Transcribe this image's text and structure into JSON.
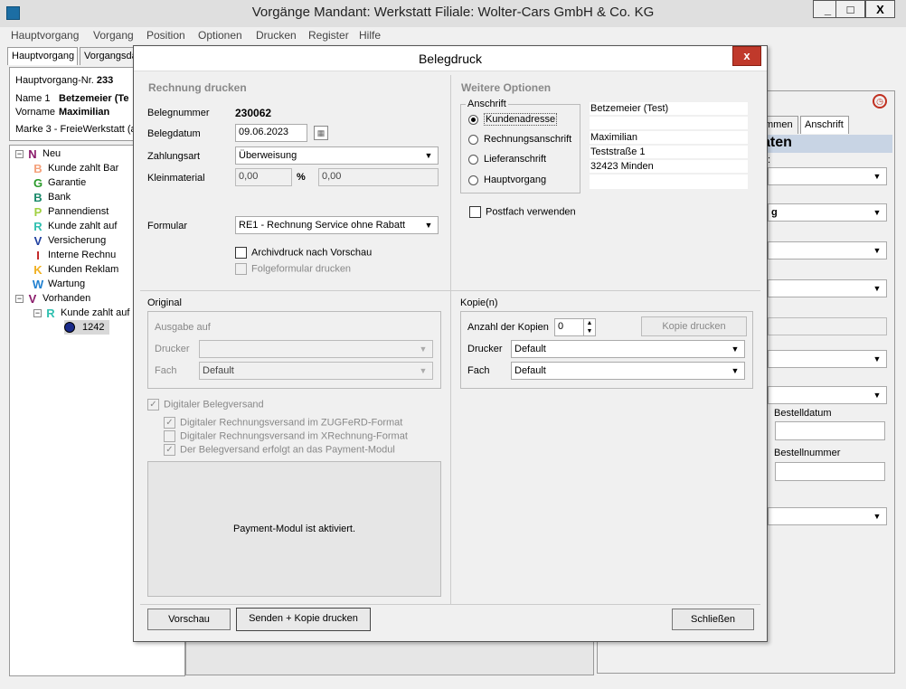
{
  "window": {
    "title": "Vorgänge   Mandant: Werkstatt   Filiale: Wolter-Cars GmbH & Co. KG",
    "minimize": "_",
    "maximize": "□",
    "close": "X"
  },
  "menu": [
    "Hauptvorgang",
    "Vorgang",
    "Position",
    "Optionen",
    "Drucken",
    "Register",
    "Hilfe"
  ],
  "tabs": {
    "hauptvorgang": "Hauptvorgang",
    "vorgangsdaten": "Vorgangsda"
  },
  "info": {
    "hv_label": "Hauptvorgang-Nr.",
    "hv_value": "233",
    "name_label": "Name 1",
    "name_value": "Betzemeier (Te",
    "vorname_label": "Vorname",
    "vorname_value": "Maximilian",
    "marke": "Marke 3 - FreieWerkstatt (a"
  },
  "tree": {
    "neu": {
      "letter": "N",
      "label": "Neu"
    },
    "items": [
      {
        "letter": "B",
        "color": "#f4a07a",
        "label": "Kunde zahlt Bar"
      },
      {
        "letter": "G",
        "color": "#2a9a2a",
        "label": "Garantie"
      },
      {
        "letter": "B",
        "color": "#1a8a6a",
        "label": "Bank"
      },
      {
        "letter": "P",
        "color": "#a0d040",
        "label": "Pannendienst"
      },
      {
        "letter": "R",
        "color": "#30c0b0",
        "label": "Kunde zahlt auf"
      },
      {
        "letter": "V",
        "color": "#2040a0",
        "label": "Versicherung"
      },
      {
        "letter": "I",
        "color": "#c02020",
        "label": "Interne Rechnu"
      },
      {
        "letter": "K",
        "color": "#f0b020",
        "label": "Kunden Reklam"
      },
      {
        "letter": "W",
        "color": "#2080d0",
        "label": "Wartung"
      }
    ],
    "vorhanden": {
      "letter": "V",
      "label": "Vorhanden"
    },
    "vorhanden_child": {
      "letter": "R",
      "label": "Kunde zahlt auf"
    },
    "leaf": "1242"
  },
  "right_panel": {
    "tab1": "mmen",
    "tab2": "Anschrift",
    "heading": "aten",
    "heading_suffix": ":",
    "combo_text": "g",
    "bestelldatum_label": "Bestelldatum",
    "bestellnummer_label": "Bestellnummer"
  },
  "dialog": {
    "title": "Belegdruck",
    "close": "x",
    "rechnung": {
      "heading": "Rechnung drucken",
      "belegnummer_label": "Belegnummer",
      "belegnummer_value": "230062",
      "belegdatum_label": "Belegdatum",
      "belegdatum_value": "09.06.2023",
      "zahlungsart_label": "Zahlungsart",
      "zahlungsart_value": "Überweisung",
      "kleinmaterial_label": "Kleinmaterial",
      "kleinmaterial_pct": "0,00",
      "percent_sign": "%",
      "kleinmaterial_value": "0,00",
      "formular_label": "Formular",
      "formular_value": "RE1 - Rechnung Service ohne Rabatt",
      "archivdruck": "Archivdruck nach Vorschau",
      "folgeformular": "Folgeformular drucken"
    },
    "weitere": {
      "heading": "Weitere Optionen",
      "anschrift_legend": "Anschrift",
      "options": [
        "Kundenadresse",
        "Rechnungsanschrift",
        "Lieferanschrift",
        "Hauptvorgang"
      ],
      "address": {
        "line1": "Betzemeier (Test)",
        "line2": "",
        "line3": "Maximilian",
        "line4": "Teststraße 1",
        "line5": "32423 Minden",
        "line6": ""
      },
      "postfach": "Postfach verwenden"
    },
    "original": {
      "heading": "Original",
      "ausgabe": "Ausgabe auf",
      "drucker_label": "Drucker",
      "drucker_value": "",
      "fach_label": "Fach",
      "fach_value": "Default"
    },
    "kopie": {
      "heading": "Kopie(n)",
      "anzahl_label": "Anzahl der Kopien",
      "anzahl_value": "0",
      "kopie_button": "Kopie drucken",
      "drucker_label": "Drucker",
      "drucker_value": "Default",
      "fach_label": "Fach",
      "fach_value": "Default"
    },
    "digital": {
      "main": "Digitaler Belegversand",
      "opt1": "Digitaler Rechnungsversand im ZUGFeRD-Format",
      "opt2": "Digitaler Rechnungsversand im XRechnung-Format",
      "opt3": "Der Belegversand erfolgt an das Payment-Modul"
    },
    "payment_text": "Payment-Modul ist aktiviert.",
    "buttons": {
      "vorschau": "Vorschau",
      "senden": "Senden + Kopie drucken",
      "schliessen": "Schließen"
    }
  }
}
